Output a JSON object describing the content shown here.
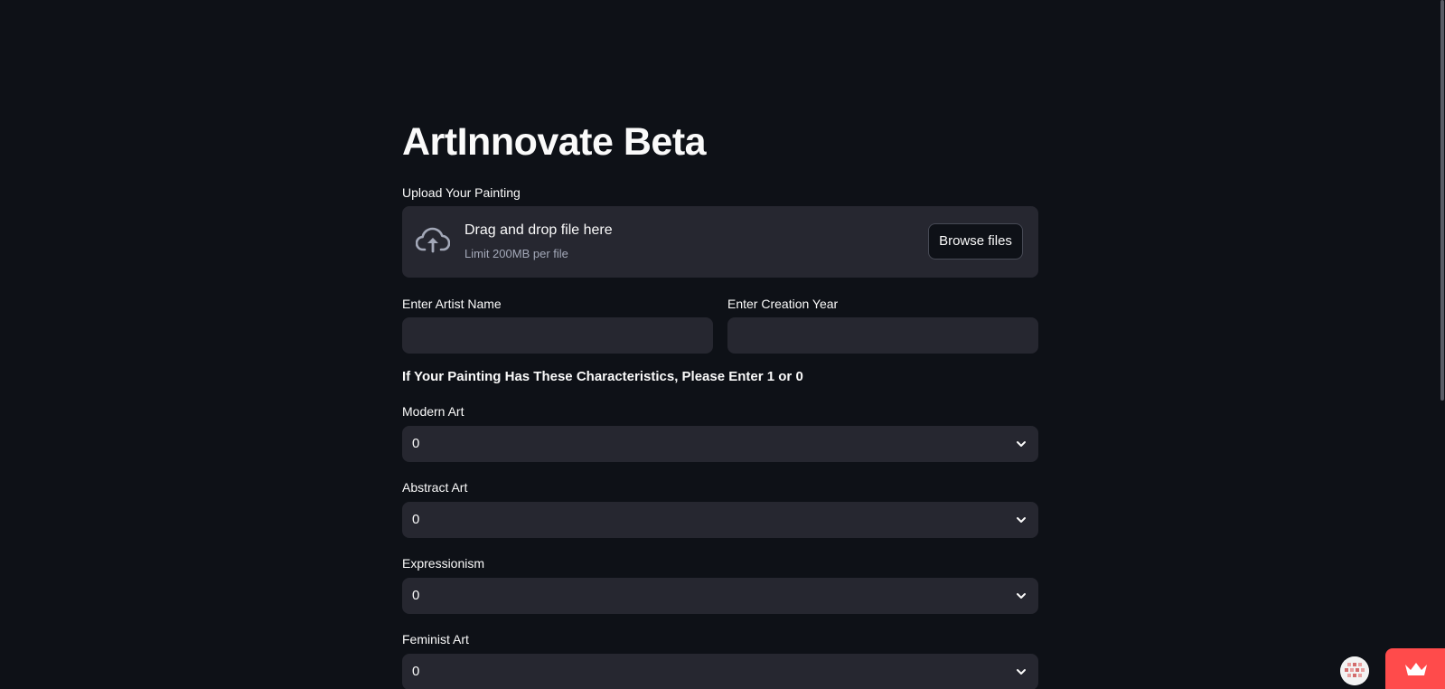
{
  "page": {
    "title": "ArtInnovate Beta"
  },
  "uploader": {
    "label": "Upload Your Painting",
    "drag_text": "Drag and drop file here",
    "limit_text": "Limit 200MB per file",
    "browse_label": "Browse files"
  },
  "artist_field": {
    "label": "Enter Artist Name",
    "value": ""
  },
  "year_field": {
    "label": "Enter Creation Year",
    "value": ""
  },
  "characteristics": {
    "heading": "If Your Painting Has These Characteristics, Please Enter 1 or 0",
    "selects": [
      {
        "label": "Modern Art",
        "value": "0"
      },
      {
        "label": "Abstract Art",
        "value": "0"
      },
      {
        "label": "Expressionism",
        "value": "0"
      },
      {
        "label": "Feminist Art",
        "value": "0"
      }
    ]
  },
  "colors": {
    "background": "#0e1117",
    "widget_background": "#262730",
    "accent": "#ff4b4b",
    "text": "#fafafa"
  },
  "icons": {
    "upload": "cloud-upload-icon",
    "chevron": "chevron-down-icon",
    "crown": "crown-icon",
    "avatar": "user-avatar"
  }
}
